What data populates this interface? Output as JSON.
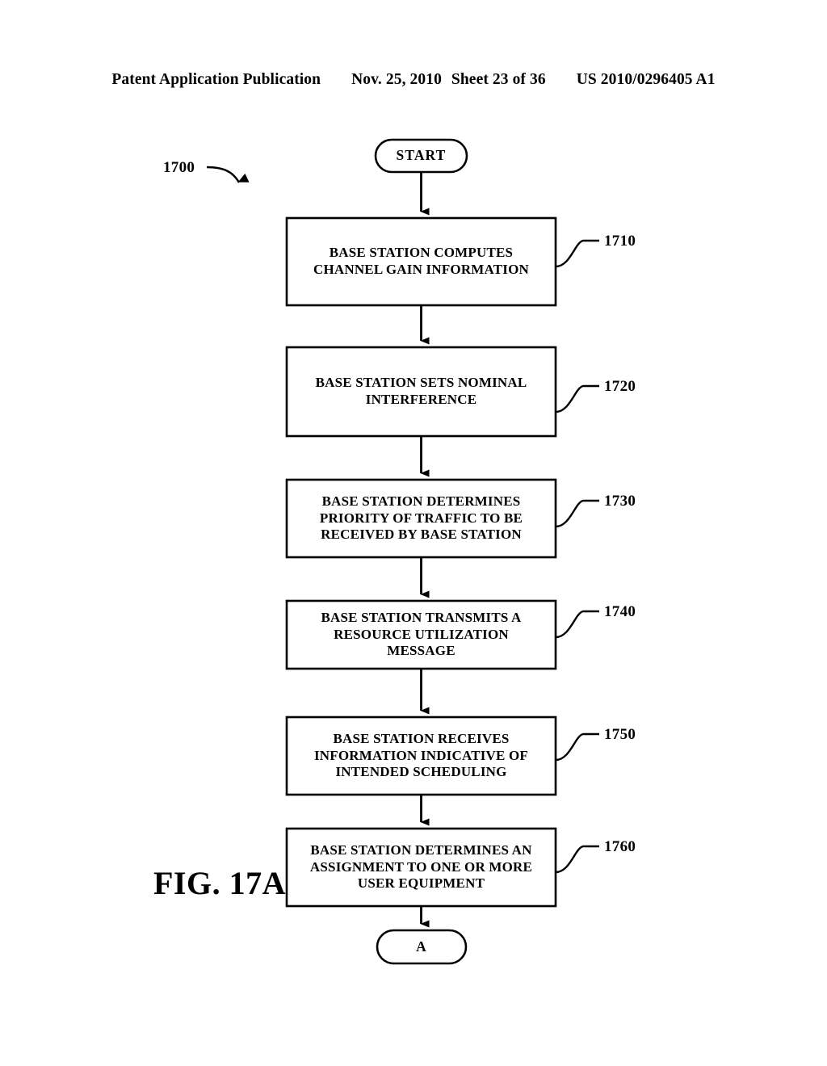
{
  "header": {
    "publication": "Patent Application Publication",
    "date": "Nov. 25, 2010",
    "sheet": "Sheet 23 of 36",
    "patent_number": "US 2010/0296405 A1"
  },
  "figure": {
    "caption": "FIG. 17A",
    "flow_reference": "1700"
  },
  "flowchart": {
    "start": {
      "label": "START"
    },
    "steps": [
      {
        "ref": "1710",
        "lines": [
          "BASE STATION COMPUTES",
          "CHANNEL GAIN INFORMATION"
        ]
      },
      {
        "ref": "1720",
        "lines": [
          "BASE STATION SETS NOMINAL",
          "INTERFERENCE"
        ]
      },
      {
        "ref": "1730",
        "lines": [
          "BASE STATION DETERMINES",
          "PRIORITY OF TRAFFIC TO BE",
          "RECEIVED BY BASE STATION"
        ]
      },
      {
        "ref": "1740",
        "lines": [
          "BASE STATION TRANSMITS A",
          "RESOURCE UTILIZATION",
          "MESSAGE"
        ]
      },
      {
        "ref": "1750",
        "lines": [
          "BASE STATION RECEIVES",
          "INFORMATION INDICATIVE OF",
          "INTENDED SCHEDULING"
        ]
      },
      {
        "ref": "1760",
        "lines": [
          "BASE STATION DETERMINES AN",
          "ASSIGNMENT TO ONE OR MORE",
          "USER EQUIPMENT"
        ]
      }
    ],
    "end_connector": {
      "label": "A"
    }
  },
  "colors": {
    "ink": "#000000",
    "paper": "#ffffff"
  }
}
